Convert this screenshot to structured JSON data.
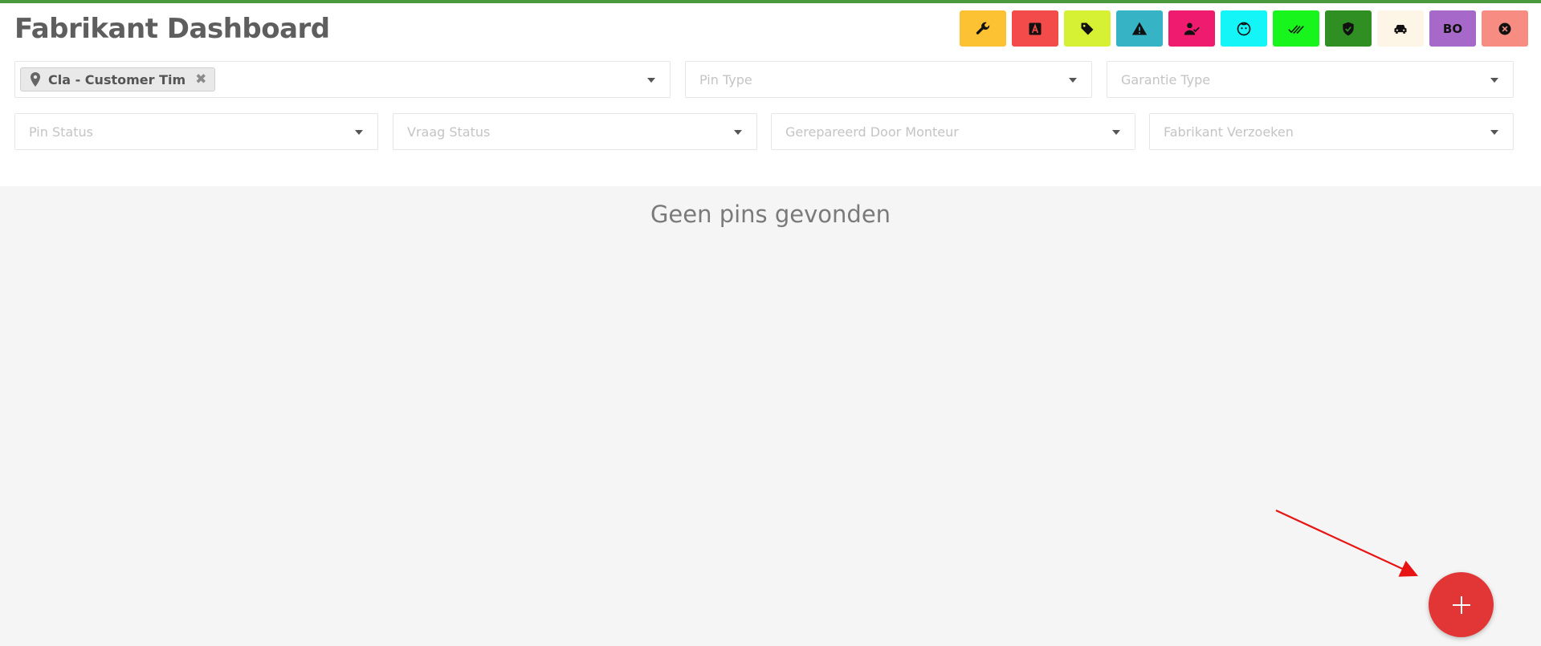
{
  "header": {
    "title": "Fabrikant Dashboard",
    "accent_color": "#4a9a3c"
  },
  "filter_buttons": [
    {
      "icon": "wrench-icon",
      "color": "#fdc234"
    },
    {
      "icon": "letter-a-icon",
      "color": "#f34a4a"
    },
    {
      "icon": "tag-icon",
      "color": "#d6f134"
    },
    {
      "icon": "warning-icon",
      "color": "#36b3c4"
    },
    {
      "icon": "user-check-icon",
      "color": "#ee1b6e"
    },
    {
      "icon": "face-icon",
      "color": "#14f5f8"
    },
    {
      "icon": "double-check-icon",
      "color": "#17f51d"
    },
    {
      "icon": "shield-check-icon",
      "color": "#2f8f22"
    },
    {
      "icon": "car-icon",
      "color": "#fdf5e6"
    },
    {
      "icon": "text-icon",
      "label": "BO",
      "color": "#a668c9"
    },
    {
      "icon": "close-circle-icon",
      "color": "#f68c82"
    }
  ],
  "filters": {
    "customer": {
      "chip_label": "Cla - Customer Tim",
      "chip_remove": "✖"
    },
    "pin_type": {
      "placeholder": "Pin Type"
    },
    "garantie_type": {
      "placeholder": "Garantie Type"
    },
    "pin_status": {
      "placeholder": "Pin Status"
    },
    "vraag_status": {
      "placeholder": "Vraag Status"
    },
    "gerepareerd_door": {
      "placeholder": "Gerepareerd Door Monteur"
    },
    "fabrikant_verzoeken": {
      "placeholder": "Fabrikant Verzoeken"
    }
  },
  "main": {
    "empty_message": "Geen pins gevonden"
  },
  "fab": {
    "icon": "plus-icon",
    "color": "#e23535"
  },
  "annotation": {
    "icon": "arrow-icon",
    "color": "#e81414"
  }
}
